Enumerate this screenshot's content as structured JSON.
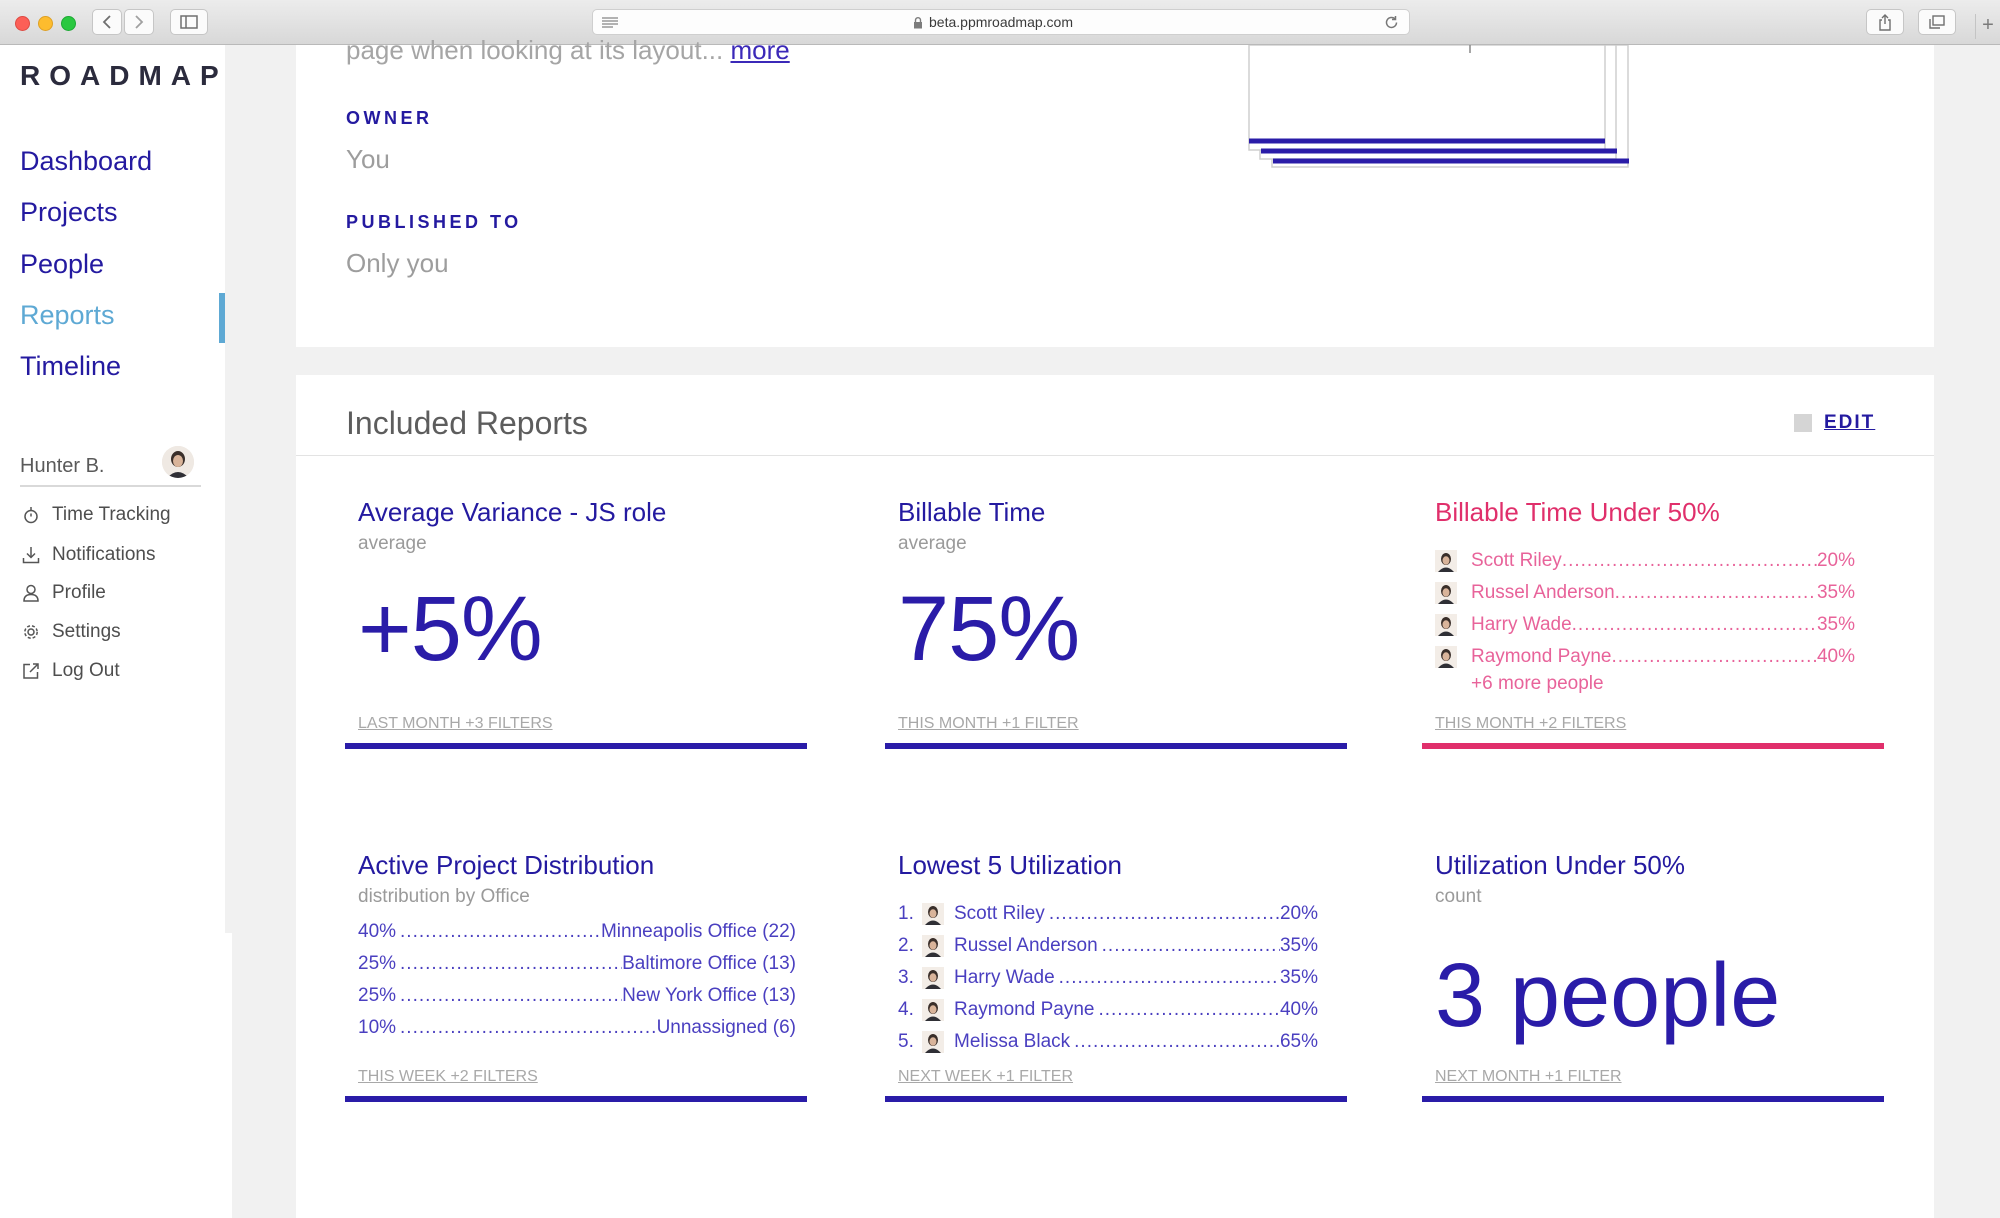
{
  "browser": {
    "url": "beta.ppmroadmap.com"
  },
  "sidebar": {
    "brand": "ROADMAP",
    "nav": [
      {
        "label": "Dashboard"
      },
      {
        "label": "Projects"
      },
      {
        "label": "People"
      },
      {
        "label": "Reports",
        "active": true
      },
      {
        "label": "Timeline"
      }
    ],
    "user": {
      "name": "Hunter B."
    },
    "menu": [
      {
        "label": "Time Tracking",
        "icon": "stopwatch-icon"
      },
      {
        "label": "Notifications",
        "icon": "download-icon"
      },
      {
        "label": "Profile",
        "icon": "person-icon"
      },
      {
        "label": "Settings",
        "icon": "gear-icon"
      },
      {
        "label": "Log Out",
        "icon": "external-link-icon"
      }
    ]
  },
  "report_info": {
    "description": "page when looking at its layout...",
    "more_label": "more",
    "owner_label": "OWNER",
    "owner_value": "You",
    "published_label": "PUBLISHED TO",
    "published_value": "Only you"
  },
  "included_reports": {
    "title": "Included Reports",
    "edit_label": "EDIT",
    "reports": [
      {
        "title": "Average Variance - JS role",
        "subtitle": "average",
        "value": "+5%",
        "footer": "LAST MONTH +3 FILTERS"
      },
      {
        "title": "Billable Time",
        "subtitle": "average",
        "value": "75%",
        "footer": "THIS MONTH +1 FILTER"
      },
      {
        "title": "Billable Time Under 50%",
        "people": [
          {
            "name": "Scott Riley",
            "percent": "20%"
          },
          {
            "name": "Russel Anderson",
            "percent": "35%"
          },
          {
            "name": "Harry Wade",
            "percent": "35%"
          },
          {
            "name": "Raymond Payne",
            "percent": "40%"
          }
        ],
        "more": "+6 more people",
        "footer": "THIS MONTH +2 FILTERS",
        "accent": "#e02f6b"
      },
      {
        "title": "Active Project Distribution",
        "subtitle": "distribution by Office",
        "rows": [
          {
            "percent": "40%",
            "office": "Minneapolis Office (22)"
          },
          {
            "percent": "25%",
            "office": "Baltimore Office (13)"
          },
          {
            "percent": "25%",
            "office": "New York Office (13)"
          },
          {
            "percent": "10%",
            "office": "Unnassigned (6)"
          }
        ],
        "footer": "THIS WEEK +2 FILTERS"
      },
      {
        "title": "Lowest  5 Utilization",
        "rows": [
          {
            "rank": "1.",
            "name": "Scott Riley",
            "percent": "20%"
          },
          {
            "rank": "2.",
            "name": "Russel Anderson",
            "percent": "35%"
          },
          {
            "rank": "3.",
            "name": "Harry Wade",
            "percent": "35%"
          },
          {
            "rank": "4.",
            "name": "Raymond Payne",
            "percent": "40%"
          },
          {
            "rank": "5.",
            "name": "Melissa Black",
            "percent": "65%"
          }
        ],
        "footer": "NEXT WEEK +1 FILTER"
      },
      {
        "title": "Utilization Under 50%",
        "subtitle": "count",
        "value": "3 people",
        "footer": "NEXT MONTH +1 FILTER"
      }
    ]
  },
  "colors": {
    "primary": "#2a1ca8",
    "accent_pink": "#e02f6b",
    "active_nav": "#5ea9d4"
  }
}
